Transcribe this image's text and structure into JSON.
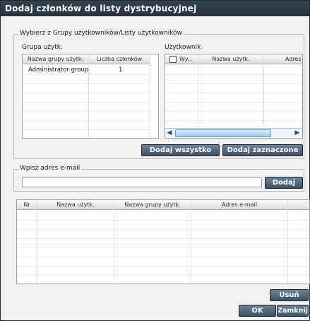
{
  "window": {
    "title": "Dodaj członków do listy dystrybucyjnej"
  },
  "select_group": {
    "legend": "Wybierz z Grupy użytkowników/Listy użytkowników",
    "group_label": "Grupa użytk.",
    "user_label": "Użytkownik",
    "group_table": {
      "columns": [
        "Nazwa grupy użytk.",
        "Liczba członków"
      ],
      "rows": [
        {
          "name": "Administrator group",
          "count": "1"
        }
      ]
    },
    "user_table": {
      "columns": [
        "Wy...",
        "Nazwa użytk.",
        "Adres e"
      ]
    },
    "add_all_label": "Dodaj wszystko",
    "add_selected_label": "Dodaj zaznaczone"
  },
  "email_section": {
    "legend": "Wpisz adres e-mail",
    "input_value": "",
    "add_label": "Dodaj"
  },
  "members_table": {
    "columns": [
      "Nr",
      "Nazwa użytk.",
      "Nazwa grupy użytk.",
      "Adres e-mail"
    ]
  },
  "footer": {
    "remove_label": "Usuń",
    "ok_label": "OK",
    "close_label": "Zamknij"
  },
  "colors": {
    "titlebar": "#2e3a46",
    "button": "#55697e"
  }
}
